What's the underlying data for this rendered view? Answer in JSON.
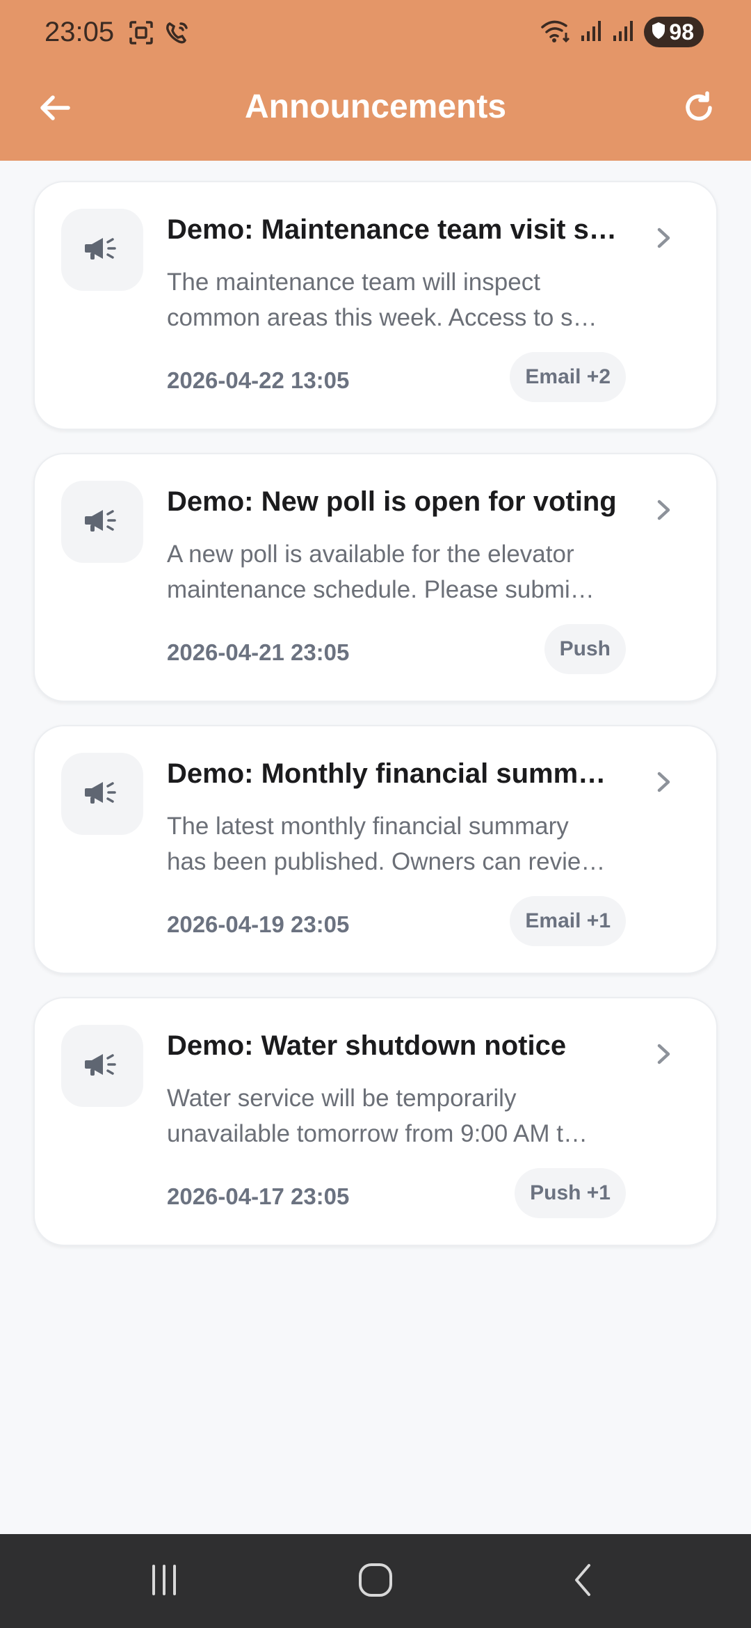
{
  "status_bar": {
    "time": "23:05",
    "battery": "98",
    "icons_left": [
      "screenshot-icon",
      "wifi-calling-icon"
    ],
    "icons_right": [
      "wifi-icon",
      "signal-icon",
      "signal-icon",
      "battery-icon"
    ]
  },
  "app_bar": {
    "title": "Announcements",
    "back_icon": "arrow-left-icon",
    "refresh_icon": "refresh-icon",
    "color": "#e49668"
  },
  "announcements": [
    {
      "title": "Demo: Maintenance team visit s…",
      "body_line1": "The maintenance team will inspect",
      "body_line2": "common areas this week. Access to s…",
      "date": "2026-04-22 13:05",
      "channels": "Email +2"
    },
    {
      "title": "Demo: New poll is open for voting",
      "body_line1": "A new poll is available for the elevator",
      "body_line2": "maintenance schedule. Please submi…",
      "date": "2026-04-21 23:05",
      "channels": "Push"
    },
    {
      "title": "Demo: Monthly financial summ…",
      "body_line1": "The latest monthly financial summary",
      "body_line2": "has been published. Owners can revie…",
      "date": "2026-04-19 23:05",
      "channels": "Email +1"
    },
    {
      "title": "Demo: Water shutdown notice",
      "body_line1": "Water service will be temporarily",
      "body_line2": "unavailable tomorrow from 9:00 AM t…",
      "date": "2026-04-17 23:05",
      "channels": "Push +1"
    }
  ],
  "nav_bar": {
    "buttons": [
      "recent-apps-icon",
      "home-icon",
      "back-icon"
    ]
  }
}
